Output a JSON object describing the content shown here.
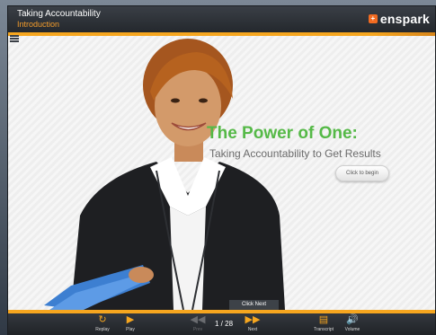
{
  "window": {
    "course_title": "Taking Accountability",
    "section_title": "Introduction",
    "brand": "enspark"
  },
  "slide": {
    "headline": "The Power of One:",
    "subheadline": "Taking Accountability to Get Results",
    "begin_button": "Click to begin",
    "hint": "Click Next"
  },
  "controls": {
    "replay": "Replay",
    "play": "Play",
    "prev": "Prev",
    "page": "1 / 28",
    "next": "Next",
    "transcript": "Transcript",
    "volume": "Volume"
  },
  "colors": {
    "accent": "#f6a61f",
    "headline": "#55b947",
    "brand": "#f26b21"
  }
}
